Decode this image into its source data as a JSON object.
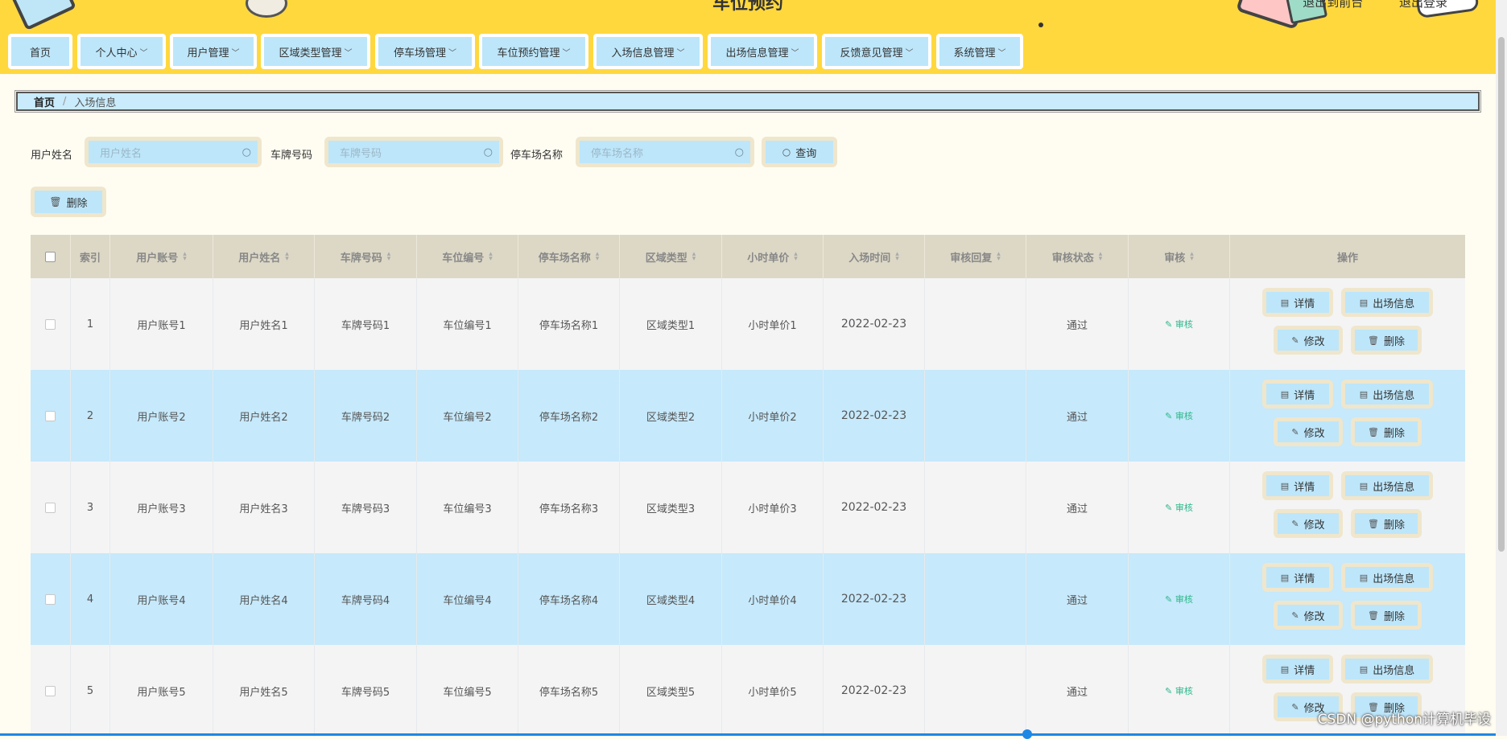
{
  "header": {
    "site_title": "车位预约",
    "links": [
      "退出到前台",
      "退出登录"
    ]
  },
  "menu": [
    {
      "label": "首页",
      "has_dropdown": false
    },
    {
      "label": "个人中心",
      "has_dropdown": true
    },
    {
      "label": "用户管理",
      "has_dropdown": true
    },
    {
      "label": "区域类型管理",
      "has_dropdown": true
    },
    {
      "label": "停车场管理",
      "has_dropdown": true
    },
    {
      "label": "车位预约管理",
      "has_dropdown": true
    },
    {
      "label": "入场信息管理",
      "has_dropdown": true
    },
    {
      "label": "出场信息管理",
      "has_dropdown": true
    },
    {
      "label": "反馈意见管理",
      "has_dropdown": true
    },
    {
      "label": "系统管理",
      "has_dropdown": true
    }
  ],
  "breadcrumb": {
    "home": "首页",
    "separator": "/",
    "current": "入场信息"
  },
  "search": {
    "fields": [
      {
        "label": "用户姓名",
        "placeholder": "用户姓名"
      },
      {
        "label": "车牌号码",
        "placeholder": "车牌号码"
      },
      {
        "label": "停车场名称",
        "placeholder": "停车场名称"
      }
    ],
    "query_label": "查询",
    "delete_label": "删除"
  },
  "table": {
    "columns": [
      "索引",
      "用户账号",
      "用户姓名",
      "车牌号码",
      "车位编号",
      "停车场名称",
      "区域类型",
      "小时单价",
      "入场时间",
      "审核回复",
      "审核状态",
      "审核",
      "操作"
    ],
    "audit_link": "审核",
    "actions": {
      "detail": "详情",
      "exit_info": "出场信息",
      "edit": "修改",
      "delete": "删除"
    },
    "rows": [
      {
        "index": "1",
        "account": "用户账号1",
        "name": "用户姓名1",
        "plate": "车牌号码1",
        "spot": "车位编号1",
        "lot": "停车场名称1",
        "area": "区域类型1",
        "price": "小时单价1",
        "time": "2022-02-23",
        "reply": "",
        "status": "通过"
      },
      {
        "index": "2",
        "account": "用户账号2",
        "name": "用户姓名2",
        "plate": "车牌号码2",
        "spot": "车位编号2",
        "lot": "停车场名称2",
        "area": "区域类型2",
        "price": "小时单价2",
        "time": "2022-02-23",
        "reply": "",
        "status": "通过"
      },
      {
        "index": "3",
        "account": "用户账号3",
        "name": "用户姓名3",
        "plate": "车牌号码3",
        "spot": "车位编号3",
        "lot": "停车场名称3",
        "area": "区域类型3",
        "price": "小时单价3",
        "time": "2022-02-23",
        "reply": "",
        "status": "通过"
      },
      {
        "index": "4",
        "account": "用户账号4",
        "name": "用户姓名4",
        "plate": "车牌号码4",
        "spot": "车位编号4",
        "lot": "停车场名称4",
        "area": "区域类型4",
        "price": "小时单价4",
        "time": "2022-02-23",
        "reply": "",
        "status": "通过"
      },
      {
        "index": "5",
        "account": "用户账号5",
        "name": "用户姓名5",
        "plate": "车牌号码5",
        "spot": "车位编号5",
        "lot": "停车场名称5",
        "area": "区域类型5",
        "price": "小时单价5",
        "time": "2022-02-23",
        "reply": "",
        "status": "通过"
      }
    ]
  },
  "watermark": "CSDN @python计算机毕设",
  "colors": {
    "header_bg": "#ffd83e",
    "button_bg": "#bde6fa",
    "button_frame": "#efe6cc",
    "table_head": "#ddd8c6",
    "row_alt": "#c6e9fb",
    "audit_green": "#2db78a"
  }
}
